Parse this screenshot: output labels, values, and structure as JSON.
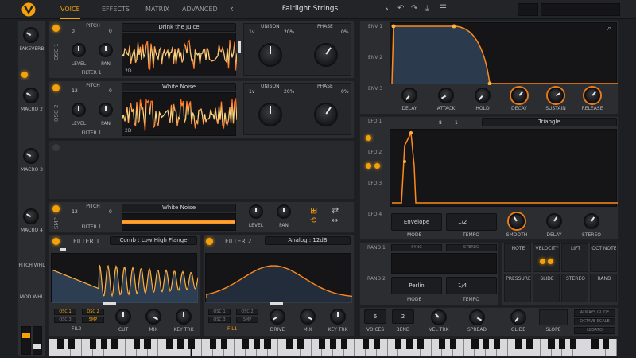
{
  "header": {
    "tabs": [
      "VOICE",
      "EFFECTS",
      "MATRIX",
      "ADVANCED"
    ],
    "preset_name": "Fairlight Strings",
    "prev": "‹",
    "next": "›"
  },
  "macros": [
    {
      "label": "FAKEVERB"
    },
    {
      "label": "MACRO 2"
    },
    {
      "label": "MACRO 3"
    },
    {
      "label": "MACRO 4"
    },
    {
      "label": "PITCH WHL"
    },
    {
      "label": "MOD WHL"
    }
  ],
  "osc1": {
    "title": "OSC 1",
    "pitch": "PITCH",
    "pitch_left": "0",
    "pitch_right": "0",
    "level": "LEVEL",
    "pan": "PAN",
    "filter": "FILTER 1",
    "wave": "Drink the Juice",
    "mode": "2D",
    "unison": "UNISON",
    "unison_voices": "1v",
    "unison_pct": "20%",
    "phase": "PHASE",
    "phase_pct": "0%"
  },
  "osc2": {
    "title": "OSC 2",
    "pitch": "PITCH",
    "pitch_left": "-12",
    "pitch_right": "0",
    "level": "LEVEL",
    "pan": "PAN",
    "filter": "FILTER 1",
    "wave": "White Noise",
    "mode": "2D",
    "unison": "UNISON",
    "unison_voices": "1v",
    "unison_pct": "20%",
    "phase": "PHASE",
    "phase_pct": "0%"
  },
  "smp": {
    "title": "SMP",
    "pitch": "PITCH",
    "pitch_left": "-12",
    "pitch_right": "0",
    "filter": "FILTER 1",
    "wave": "White Noise",
    "level": "LEVEL",
    "pan": "PAN"
  },
  "filter1": {
    "title": "FILTER 1",
    "model": "Comb : Low High Flange",
    "cut": "CUT",
    "mix": "MIX",
    "keytrk": "KEY TRK",
    "sources": [
      "OSC 1",
      "OSC 2",
      "OSC 3",
      "SMP"
    ],
    "route": "FIL2"
  },
  "filter2": {
    "title": "FILTER 2",
    "model": "Analog : 12dB",
    "drive": "DRIVE",
    "mix": "MIX",
    "keytrk": "KEY TRK",
    "sources": [
      "OSC 1",
      "OSC 2",
      "OSC 3",
      "SMP"
    ],
    "route": "FIL1"
  },
  "env": {
    "tabs": [
      "ENV 1",
      "ENV 2",
      "ENV 3"
    ],
    "knobs": [
      "DELAY",
      "ATTACK",
      "HOLD",
      "DECAY",
      "SUSTAIN",
      "RELEASE"
    ]
  },
  "lfo": {
    "tabs": [
      "LFO 1",
      "LFO 2",
      "LFO 3",
      "LFO 4"
    ],
    "sync_a": "8",
    "sync_b": "1",
    "shape": "Triangle",
    "mode_value": "Envelope",
    "mode_label": "MODE",
    "tempo_value": "1/2",
    "tempo_label": "TEMPO",
    "knobs": [
      "SMOOTH",
      "DELAY",
      "STEREO"
    ]
  },
  "rand": {
    "tabs": [
      "RAND 1",
      "RAND 2"
    ],
    "sync": "SYNC",
    "stereo": "STEREO",
    "mode_value": "Perlin",
    "mode_label": "MODE",
    "tempo_value": "1/4",
    "tempo_label": "TEMPO"
  },
  "modsrc": {
    "items": [
      "NOTE",
      "VELOCITY",
      "LIFT",
      "OCT NOTE",
      "PRESSURE",
      "SLIDE",
      "STEREO",
      "RAND"
    ]
  },
  "voice": {
    "voices": "6",
    "voices_label": "VOICES",
    "bend": "2",
    "bend_label": "BEND",
    "veltrk": "VEL TRK",
    "spread": "SPREAD",
    "glide": "GLIDE",
    "slope": "SLOPE",
    "options": [
      "ALWAYS GLIDE",
      "OCTAVE SCALE",
      "LEGATO"
    ]
  },
  "colors": {
    "accent": "#f5a20a",
    "wave": "#ff8a1a",
    "panel": "#2c2d31"
  }
}
